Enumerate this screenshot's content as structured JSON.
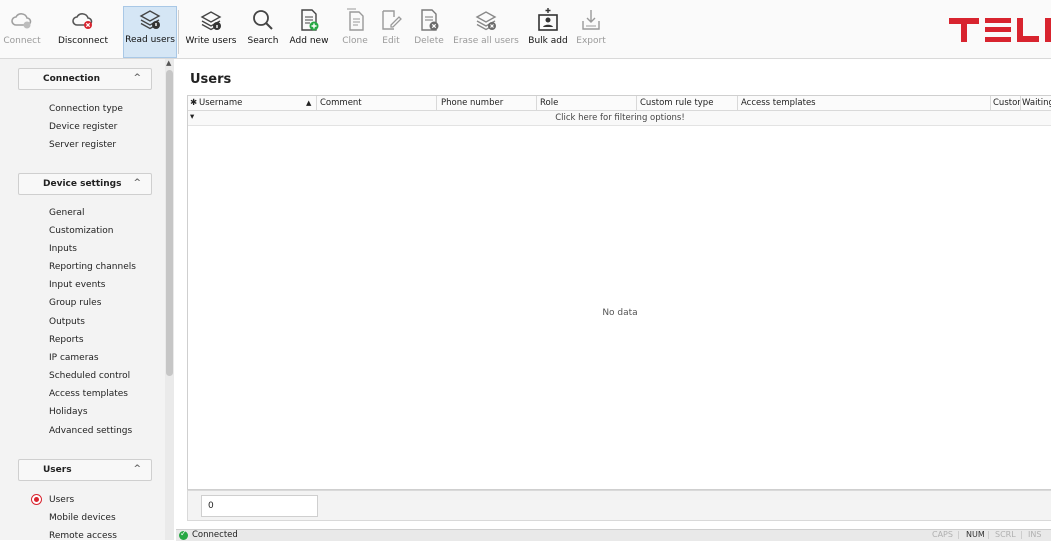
{
  "toolbar": {
    "buttons": [
      {
        "label": "Connect",
        "icon": "cloud-connect-icon",
        "disabled": true
      },
      {
        "label": "Disconnect",
        "icon": "cloud-disconnect-icon",
        "disabled": false
      },
      {
        "label": "Read users",
        "icon": "read-users-icon",
        "disabled": false,
        "active": true
      },
      {
        "label": "Write users",
        "icon": "write-users-icon",
        "disabled": false
      },
      {
        "label": "Search",
        "icon": "search-icon",
        "disabled": false
      },
      {
        "label": "Add new",
        "icon": "add-new-icon",
        "disabled": false
      },
      {
        "label": "Clone",
        "icon": "clone-icon",
        "disabled": true
      },
      {
        "label": "Edit",
        "icon": "edit-icon",
        "disabled": true
      },
      {
        "label": "Delete",
        "icon": "delete-icon",
        "disabled": true
      },
      {
        "label": "Erase all users",
        "icon": "erase-all-icon",
        "disabled": true
      },
      {
        "label": "Bulk add",
        "icon": "bulk-add-icon",
        "disabled": false
      },
      {
        "label": "Export",
        "icon": "export-icon",
        "disabled": true
      }
    ]
  },
  "sidebar": {
    "connection": {
      "title": "Connection",
      "items": [
        "Connection type",
        "Device register",
        "Server register"
      ]
    },
    "device_settings": {
      "title": "Device settings",
      "items": [
        "General",
        "Customization",
        "Inputs",
        "Reporting channels",
        "Input events",
        "Group rules",
        "Outputs",
        "Reports",
        "IP cameras",
        "Scheduled control",
        "Access templates",
        "Holidays",
        "Advanced settings"
      ]
    },
    "users": {
      "title": "Users",
      "items": [
        "Users",
        "Mobile devices",
        "Remote access"
      ],
      "selected": "Users"
    },
    "collapse_glyph": "^"
  },
  "main": {
    "title": "Users",
    "columns": [
      "Username",
      "Comment",
      "Phone number",
      "Role",
      "Custom rule type",
      "Access templates",
      "Custor",
      "Waiting"
    ],
    "filter_hint": "Click here for filtering options!",
    "empty_text": "No data",
    "count": "0"
  },
  "statusbar": {
    "status": "Connected",
    "keys": [
      "CAPS",
      "NUM",
      "SCRL",
      "INS"
    ],
    "active_key": "NUM"
  },
  "colors": {
    "brand": "#d8242f",
    "accent": "#3a7fc1",
    "status_ok": "#27a844"
  }
}
